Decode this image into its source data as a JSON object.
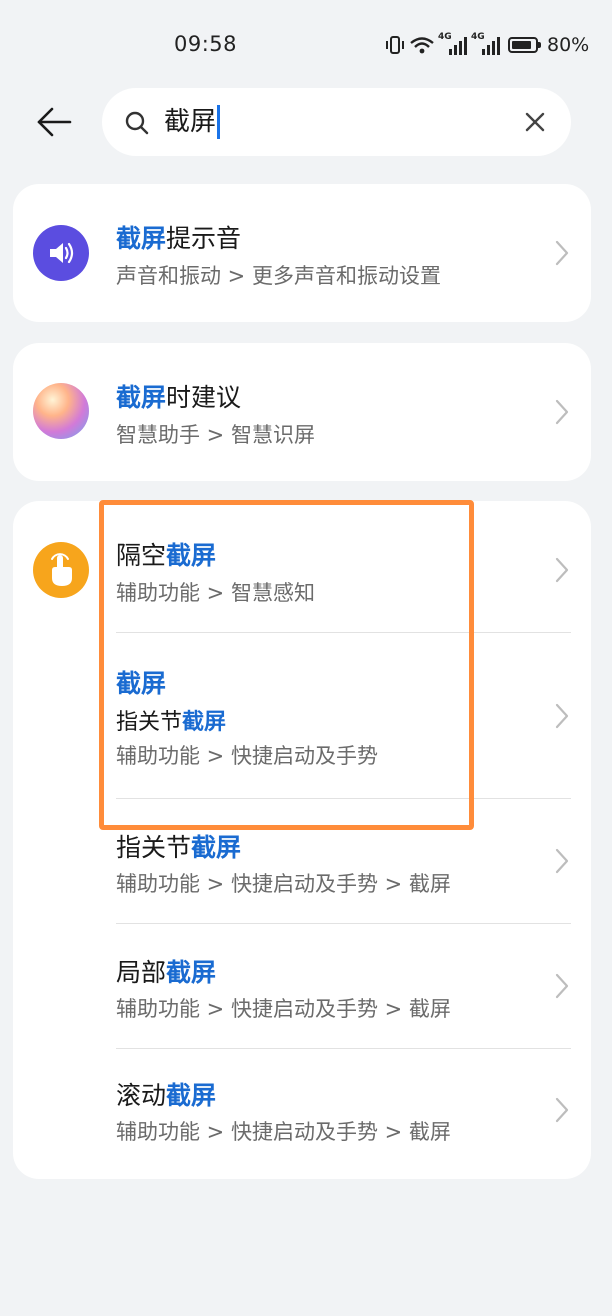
{
  "status": {
    "time": "09:58",
    "battery": "80%",
    "network1": "4G",
    "network2": "4G",
    "icons": [
      "vibrate-icon",
      "wifi-icon",
      "signal-icon",
      "signal-icon",
      "battery-icon"
    ]
  },
  "header": {
    "back_icon": "arrow-left-icon"
  },
  "search": {
    "value": "截屏",
    "icon": "search-icon",
    "clear_icon": "close-icon"
  },
  "results": [
    {
      "highlight": "截屏",
      "rest": "提示音",
      "path": "声音和振动 > 更多声音和振动设置",
      "icon": "speaker-icon",
      "icon_color": "#5b4de0"
    },
    {
      "highlight": "截屏",
      "rest": "时建议",
      "path": "智慧助手 > 智慧识屏",
      "icon": "celia-orb-icon"
    },
    {
      "icon": "hand-pointer-icon",
      "icon_color": "#f7a51c",
      "items": [
        {
          "prefix": "隔空",
          "highlight": "截屏",
          "path": "辅助功能 > 智慧感知"
        },
        {
          "highlight": "截屏",
          "sub_prefix": "指关节",
          "sub_highlight": "截屏",
          "path": "辅助功能 > 快捷启动及手势"
        },
        {
          "prefix": "指关节",
          "highlight": "截屏",
          "path": "辅助功能 > 快捷启动及手势 > 截屏"
        },
        {
          "prefix": "局部",
          "highlight": "截屏",
          "path": "辅助功能 > 快捷启动及手势 > 截屏"
        },
        {
          "prefix": "滚动",
          "highlight": "截屏",
          "path": "辅助功能 > 快捷启动及手势 > 截屏"
        }
      ]
    }
  ],
  "colors": {
    "highlight_text": "#1a6bd1",
    "annotation_box": "#ff8c3a",
    "background": "#f1f3f5"
  }
}
